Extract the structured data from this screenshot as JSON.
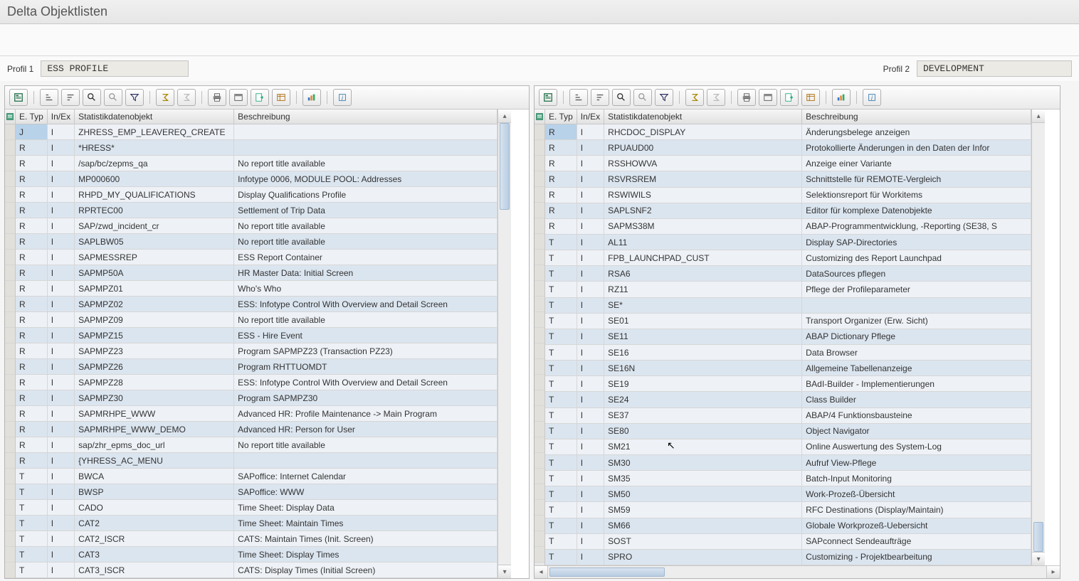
{
  "title": "Delta Objektlisten",
  "profile1": {
    "label": "Profil 1",
    "value": "ESS PROFILE"
  },
  "profile2": {
    "label": "Profil 2",
    "value": "DEVELOPMENT"
  },
  "columns": {
    "typ": "E. Typ",
    "inex": "In/Ex",
    "obj": "Statistikdatenobjekt",
    "desc": "Beschreibung"
  },
  "left_rows": [
    {
      "t": "J",
      "i": "I",
      "o": "ZHRESS_EMP_LEAVEREQ_CREATE",
      "d": ""
    },
    {
      "t": "R",
      "i": "I",
      "o": "*HRESS*",
      "d": ""
    },
    {
      "t": "R",
      "i": "I",
      "o": "/sap/bc/zepms_qa",
      "d": "No report title available"
    },
    {
      "t": "R",
      "i": "I",
      "o": "MP000600",
      "d": "Infotype 0006, MODULE POOL: Addresses"
    },
    {
      "t": "R",
      "i": "I",
      "o": "RHPD_MY_QUALIFICATIONS",
      "d": "Display Qualifications Profile"
    },
    {
      "t": "R",
      "i": "I",
      "o": "RPRTEC00",
      "d": "Settlement of Trip Data"
    },
    {
      "t": "R",
      "i": "I",
      "o": "SAP/zwd_incident_cr",
      "d": "No report title available"
    },
    {
      "t": "R",
      "i": "I",
      "o": "SAPLBW05",
      "d": "No report title available"
    },
    {
      "t": "R",
      "i": "I",
      "o": "SAPMESSREP",
      "d": "ESS Report Container"
    },
    {
      "t": "R",
      "i": "I",
      "o": "SAPMP50A",
      "d": "HR Master Data: Initial Screen"
    },
    {
      "t": "R",
      "i": "I",
      "o": "SAPMPZ01",
      "d": "Who's Who"
    },
    {
      "t": "R",
      "i": "I",
      "o": "SAPMPZ02",
      "d": "ESS: Infotype Control With Overview and Detail Screen"
    },
    {
      "t": "R",
      "i": "I",
      "o": "SAPMPZ09",
      "d": "No report title available"
    },
    {
      "t": "R",
      "i": "I",
      "o": "SAPMPZ15",
      "d": "ESS - Hire Event"
    },
    {
      "t": "R",
      "i": "I",
      "o": "SAPMPZ23",
      "d": "Program SAPMPZ23 (Transaction PZ23)"
    },
    {
      "t": "R",
      "i": "I",
      "o": "SAPMPZ26",
      "d": "Program RHTTUOMDT"
    },
    {
      "t": "R",
      "i": "I",
      "o": "SAPMPZ28",
      "d": "ESS: Infotype Control With Overview and Detail Screen"
    },
    {
      "t": "R",
      "i": "I",
      "o": "SAPMPZ30",
      "d": "Program SAPMPZ30"
    },
    {
      "t": "R",
      "i": "I",
      "o": "SAPMRHPE_WWW",
      "d": "Advanced HR: Profile Maintenance -> Main Program"
    },
    {
      "t": "R",
      "i": "I",
      "o": "SAPMRHPE_WWW_DEMO",
      "d": "Advanced HR: Person for User"
    },
    {
      "t": "R",
      "i": "I",
      "o": "sap/zhr_epms_doc_url",
      "d": "No report title available"
    },
    {
      "t": "R",
      "i": "I",
      "o": "{YHRESS_AC_MENU",
      "d": ""
    },
    {
      "t": "T",
      "i": "I",
      "o": "BWCA",
      "d": "SAPoffice: Internet Calendar"
    },
    {
      "t": "T",
      "i": "I",
      "o": "BWSP",
      "d": "SAPoffice: WWW"
    },
    {
      "t": "T",
      "i": "I",
      "o": "CADO",
      "d": "Time Sheet: Display Data"
    },
    {
      "t": "T",
      "i": "I",
      "o": "CAT2",
      "d": "Time Sheet: Maintain Times"
    },
    {
      "t": "T",
      "i": "I",
      "o": "CAT2_ISCR",
      "d": "CATS: Maintain Times (Init. Screen)"
    },
    {
      "t": "T",
      "i": "I",
      "o": "CAT3",
      "d": "Time Sheet: Display Times"
    },
    {
      "t": "T",
      "i": "I",
      "o": "CAT3_ISCR",
      "d": "CATS: Display Times (Initial Screen)"
    }
  ],
  "right_rows": [
    {
      "t": "R",
      "i": "I",
      "o": "RHCDOC_DISPLAY",
      "d": "Änderungsbelege anzeigen"
    },
    {
      "t": "R",
      "i": "I",
      "o": "RPUAUD00",
      "d": "Protokollierte Änderungen in den Daten der Infor"
    },
    {
      "t": "R",
      "i": "I",
      "o": "RSSHOWVA",
      "d": "Anzeige einer Variante"
    },
    {
      "t": "R",
      "i": "I",
      "o": "RSVRSREM",
      "d": "Schnittstelle für REMOTE-Vergleich"
    },
    {
      "t": "R",
      "i": "I",
      "o": "RSWIWILS",
      "d": "Selektionsreport für Workitems"
    },
    {
      "t": "R",
      "i": "I",
      "o": "SAPLSNF2",
      "d": "Editor für komplexe Datenobjekte"
    },
    {
      "t": "R",
      "i": "I",
      "o": "SAPMS38M",
      "d": "ABAP-Programmentwicklung, -Reporting (SE38, S"
    },
    {
      "t": "T",
      "i": "I",
      "o": "AL11",
      "d": "Display SAP-Directories"
    },
    {
      "t": "T",
      "i": "I",
      "o": "FPB_LAUNCHPAD_CUST",
      "d": "Customizing des Report Launchpad"
    },
    {
      "t": "T",
      "i": "I",
      "o": "RSA6",
      "d": "DataSources pflegen"
    },
    {
      "t": "T",
      "i": "I",
      "o": "RZ11",
      "d": "Pflege der Profileparameter"
    },
    {
      "t": "T",
      "i": "I",
      "o": "SE*",
      "d": ""
    },
    {
      "t": "T",
      "i": "I",
      "o": "SE01",
      "d": "Transport Organizer (Erw. Sicht)"
    },
    {
      "t": "T",
      "i": "I",
      "o": "SE11",
      "d": "ABAP Dictionary Pflege"
    },
    {
      "t": "T",
      "i": "I",
      "o": "SE16",
      "d": "Data Browser"
    },
    {
      "t": "T",
      "i": "I",
      "o": "SE16N",
      "d": "Allgemeine Tabellenanzeige"
    },
    {
      "t": "T",
      "i": "I",
      "o": "SE19",
      "d": "BAdI-Builder - Implementierungen"
    },
    {
      "t": "T",
      "i": "I",
      "o": "SE24",
      "d": "Class Builder"
    },
    {
      "t": "T",
      "i": "I",
      "o": "SE37",
      "d": "ABAP/4 Funktionsbausteine"
    },
    {
      "t": "T",
      "i": "I",
      "o": "SE80",
      "d": "Object Navigator"
    },
    {
      "t": "T",
      "i": "I",
      "o": "SM21",
      "d": "Online Auswertung des System-Log"
    },
    {
      "t": "T",
      "i": "I",
      "o": "SM30",
      "d": "Aufruf View-Pflege"
    },
    {
      "t": "T",
      "i": "I",
      "o": "SM35",
      "d": "Batch-Input Monitoring"
    },
    {
      "t": "T",
      "i": "I",
      "o": "SM50",
      "d": "Work-Prozeß-Übersicht"
    },
    {
      "t": "T",
      "i": "I",
      "o": "SM59",
      "d": "RFC Destinations (Display/Maintain)"
    },
    {
      "t": "T",
      "i": "I",
      "o": "SM66",
      "d": "Globale Workprozeß-Uebersicht"
    },
    {
      "t": "T",
      "i": "I",
      "o": "SOST",
      "d": "SAPconnect Sendeaufträge"
    },
    {
      "t": "T",
      "i": "I",
      "o": "SPRO",
      "d": "Customizing - Projektbearbeitung"
    }
  ]
}
